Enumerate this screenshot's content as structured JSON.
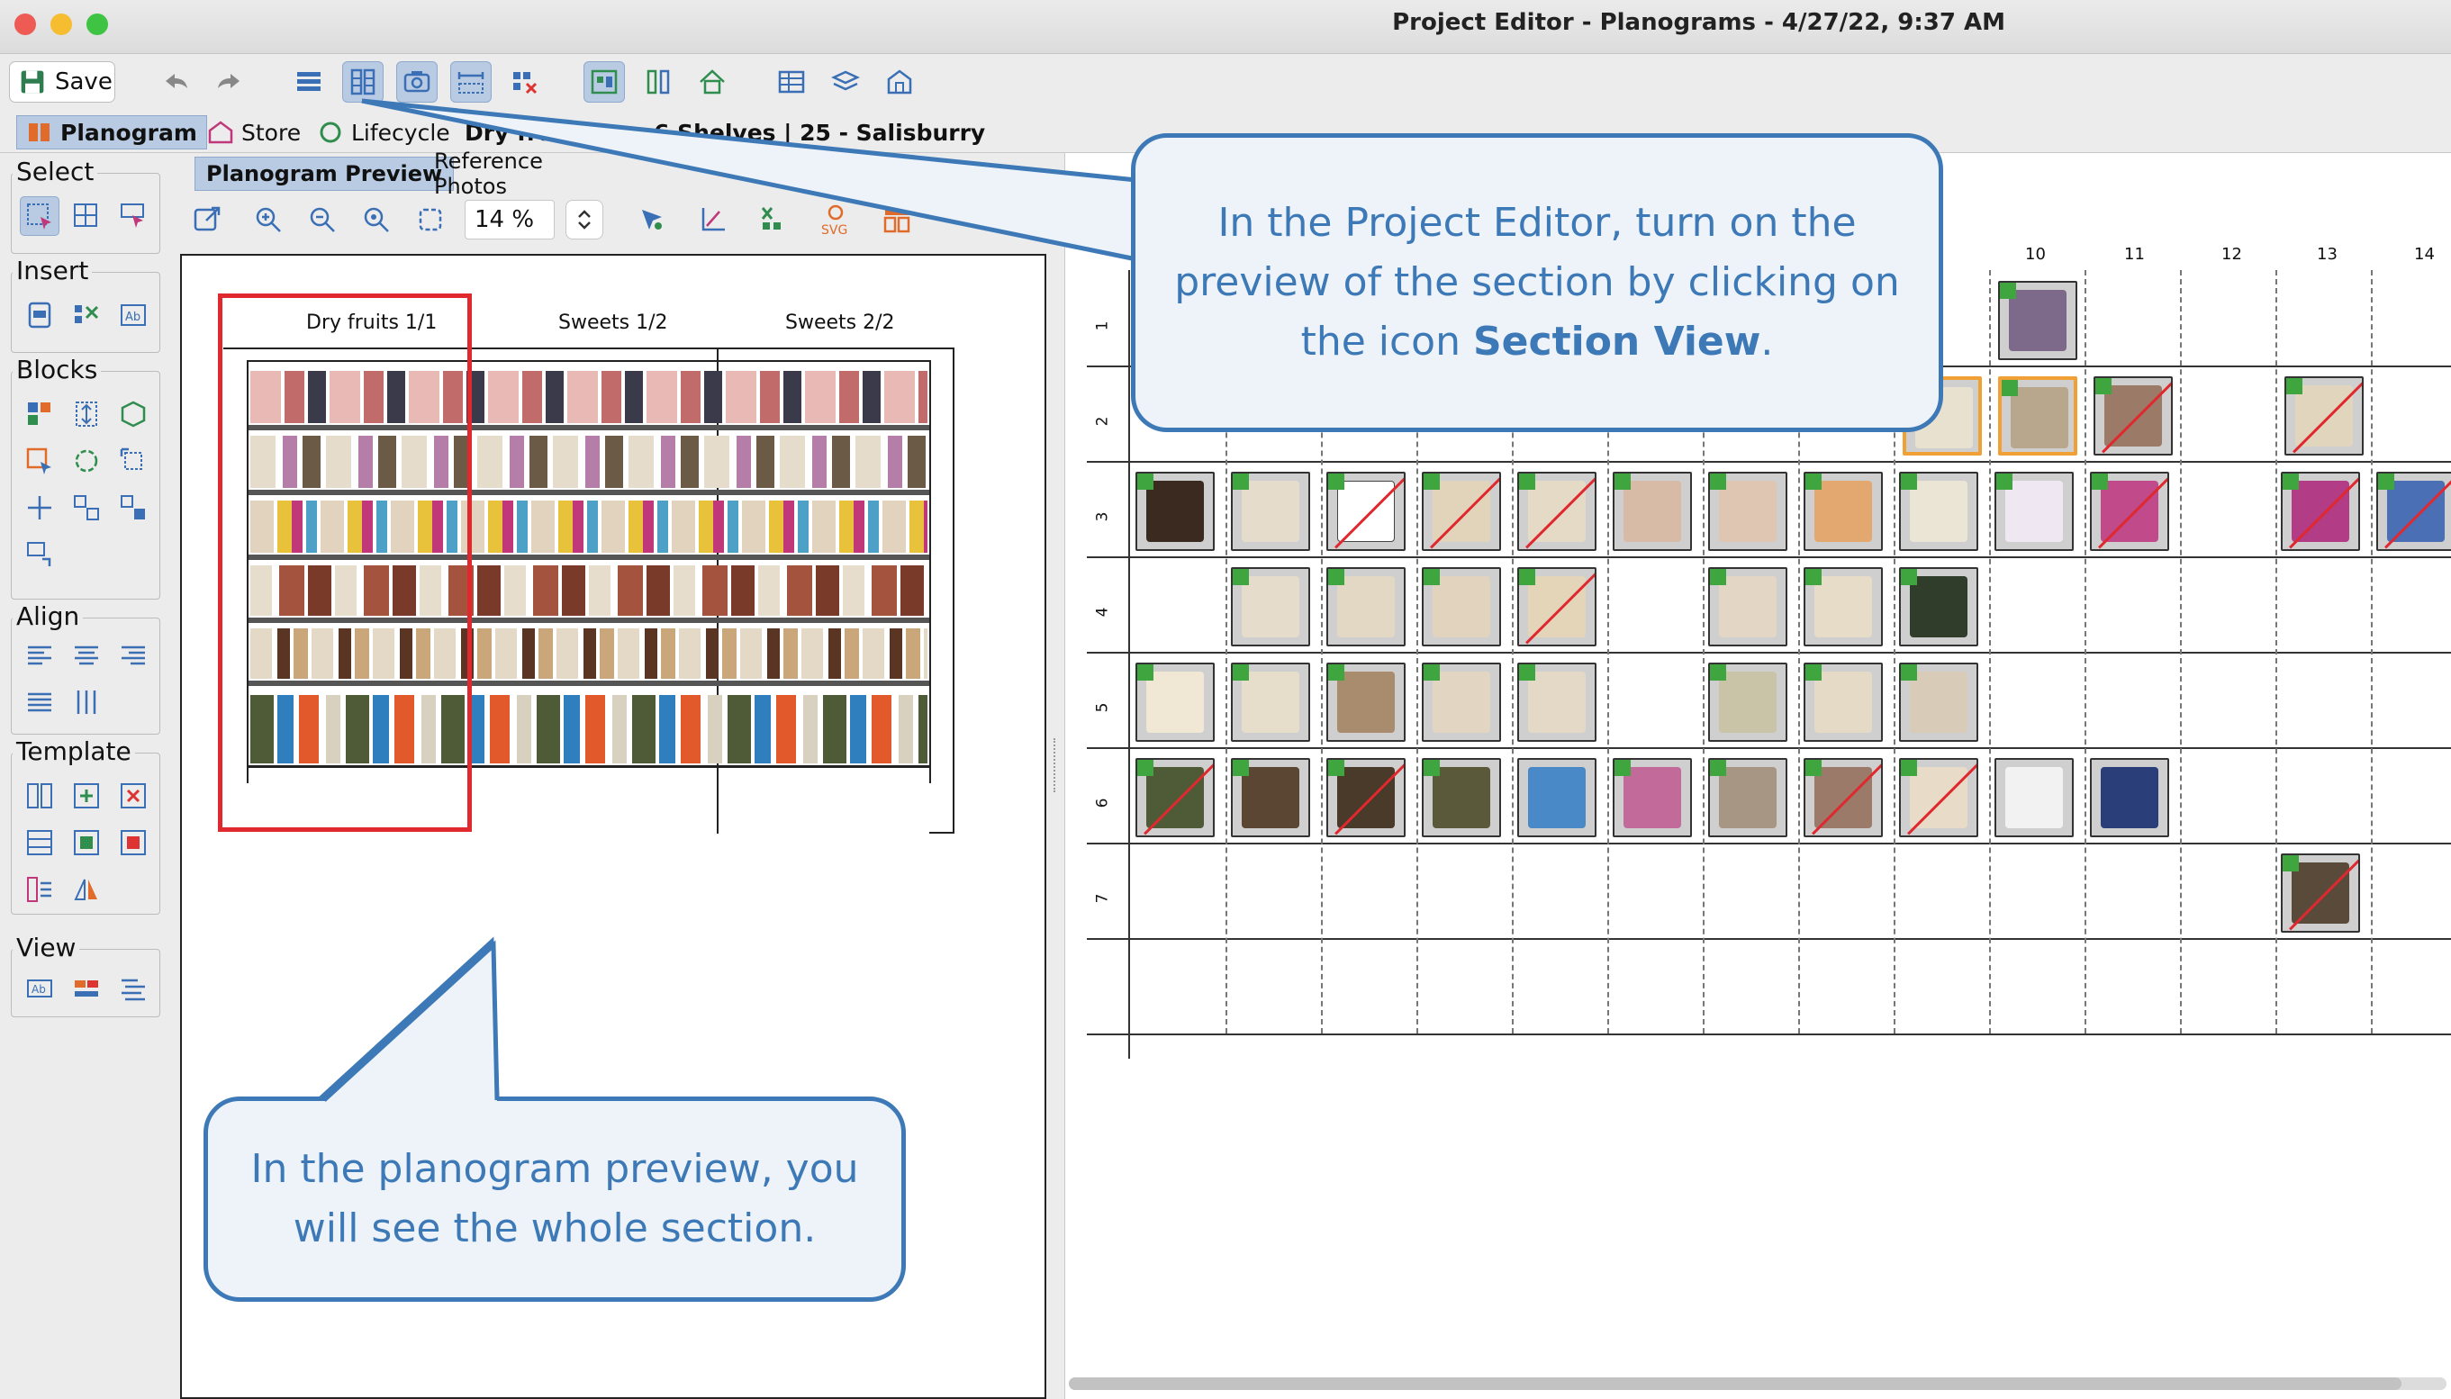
{
  "window": {
    "title": "Project Editor - Planograms - 4/27/22, 9:37 AM"
  },
  "toolbar": {
    "save_label": "Save"
  },
  "tabs": [
    {
      "label": "Planogram"
    },
    {
      "label": "Store"
    },
    {
      "label": "Lifecycle"
    },
    {
      "label": "Dry fru..."
    }
  ],
  "breadcrumb": {
    "rest": "6 Shelves | 25 - Salisburry"
  },
  "palette": {
    "select": "Select",
    "insert": "Insert",
    "blocks": "Blocks",
    "align": "Align",
    "template": "Template",
    "view": "View"
  },
  "preview_tabs": [
    {
      "label": "Planogram Preview"
    },
    {
      "label": "Reference Photos"
    }
  ],
  "zoom": {
    "value": "14 %"
  },
  "planogram": {
    "sections": [
      "Dry fruits 1/1",
      "Sweets 1/2",
      "Sweets 2/2"
    ]
  },
  "grid": {
    "columns": [
      "10",
      "11",
      "12",
      "13",
      "14"
    ],
    "rows": [
      "1",
      "2",
      "3",
      "4",
      "5",
      "6",
      "7"
    ]
  },
  "callouts": {
    "top_line1": "In the Project Editor, turn on the",
    "top_line2": "preview of the section by clicking on",
    "top_line3_pre": "the icon ",
    "top_line3_bold": "Section View",
    "top_line3_post": ".",
    "bottom_line1": "In the planogram preview, you",
    "bottom_line2": "will see the whole section."
  },
  "colors": {
    "accent": "#3d78b7",
    "callout_bg": "#eef3fa",
    "highlight": "#e0282f"
  }
}
